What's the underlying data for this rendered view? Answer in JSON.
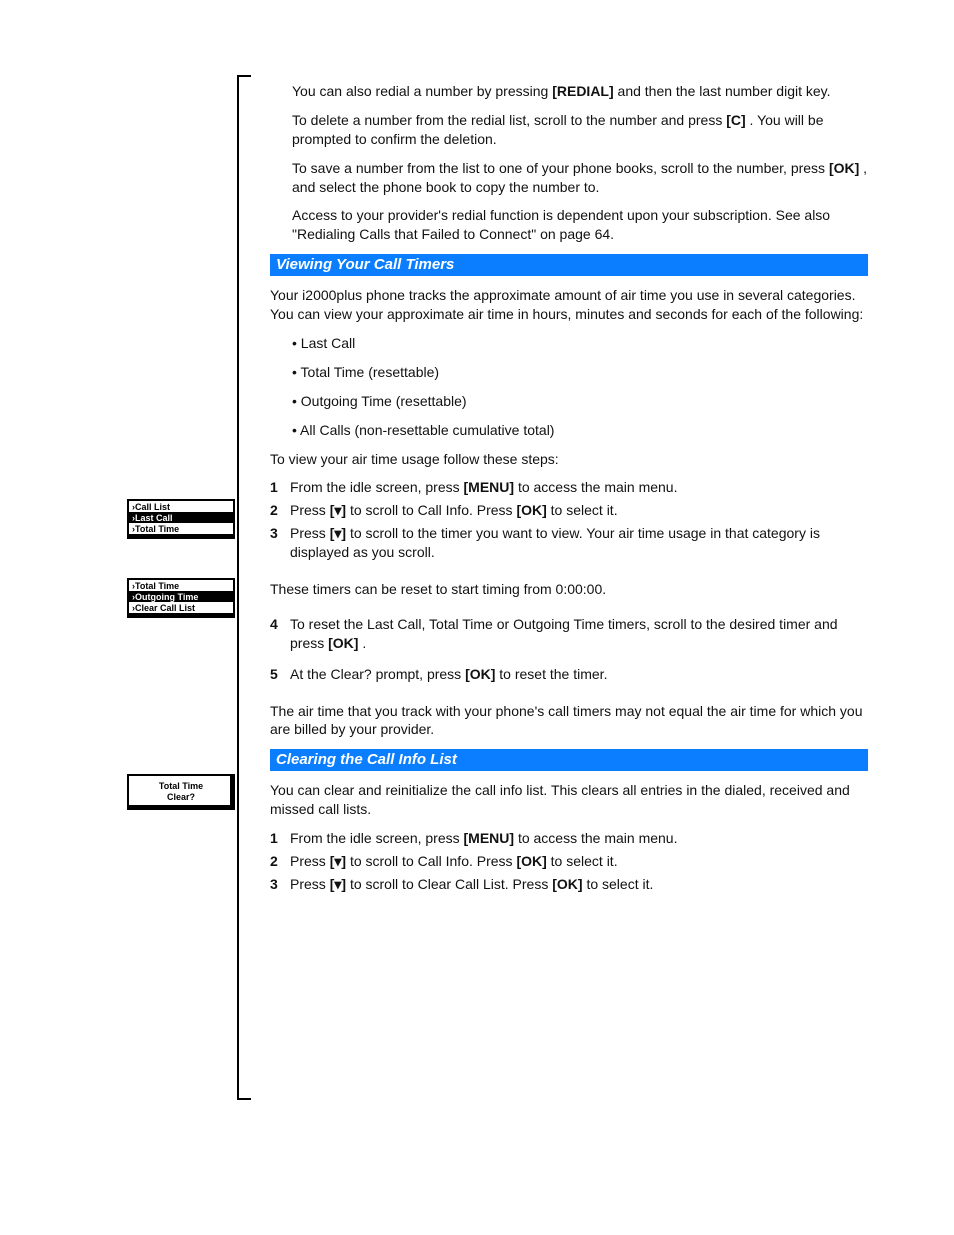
{
  "paragraphs": {
    "p1a": "You can also redial a number by pressing",
    "p1b": " and then the last number digit key.",
    "p2a": "To delete a number from the redial list, scroll to the number and press",
    "p2b": ". You will be prompted to confirm the deletion.",
    "p3a": "To save a number from the list to one of your phone books, scroll to the number, press",
    "p3b": ", and select the phone book to copy the number to.",
    "p4": "Access to your provider's redial function is dependent upon your subscription. See also \"Redialing Calls that Failed to Connect\" on page 64.",
    "h1": "Viewing Your Call Timers",
    "p5": "Your i2000plus phone tracks the approximate amount of air time you use in several categories. You can view your approximate air time in hours, minutes and seconds for each of the following:",
    "bullets": [
      "Last Call",
      "Total Time (resettable)",
      "Outgoing Time (resettable)",
      "All Calls (non-resettable cumulative total)"
    ],
    "p6": "To view your air time usage follow these steps:",
    "step1a": "From the idle screen, press",
    "step1b": " to access the main menu.",
    "step2a": "Press",
    "step2b": " to scroll to Call Info. Press",
    "step2c": " to select it.",
    "step3a": "Press",
    "step3b": " to scroll to the timer you want to view. Your air time usage in that category is displayed as you scroll.",
    "resetNote": "These timers can be reset to start timing from 0:00:00.",
    "step4a": "To reset the Last Call, Total Time or Outgoing Time timers, scroll to the desired timer and press",
    "step4b": ".",
    "step5a": "At the Clear? prompt, press",
    "step5b": " to reset the timer.",
    "p7": "The air time that you track with your phone's call timers may not equal the air time for which you are billed by your provider.",
    "h2": "Clearing the Call Info List",
    "p8": "You can clear and reinitialize the call info list. This clears all entries in the dialed, received and missed call lists.",
    "step6a": "From the idle screen, press",
    "step6b": " to access the main menu.",
    "step7a": "Press",
    "step7b": " to scroll to Call Info. Press",
    "step7c": " to select it.",
    "step8a": "Press",
    "step8b": " to scroll to Clear Call List. Press",
    "step8c": " to select it."
  },
  "keys": {
    "redial": "[REDIAL]",
    "clear": "[C]",
    "ok": "[OK]",
    "menu": "[MENU]",
    "down": "[▾]"
  },
  "lcd1": {
    "line1": "›Call List",
    "line2": "›Last Call",
    "line3": "›Total Time"
  },
  "lcd2": {
    "line1": "›Total Time",
    "line2": "›Outgoing Time",
    "line3": "›Clear Call List"
  },
  "lcd3": {
    "line1": "Total Time",
    "line2": "Clear?"
  }
}
